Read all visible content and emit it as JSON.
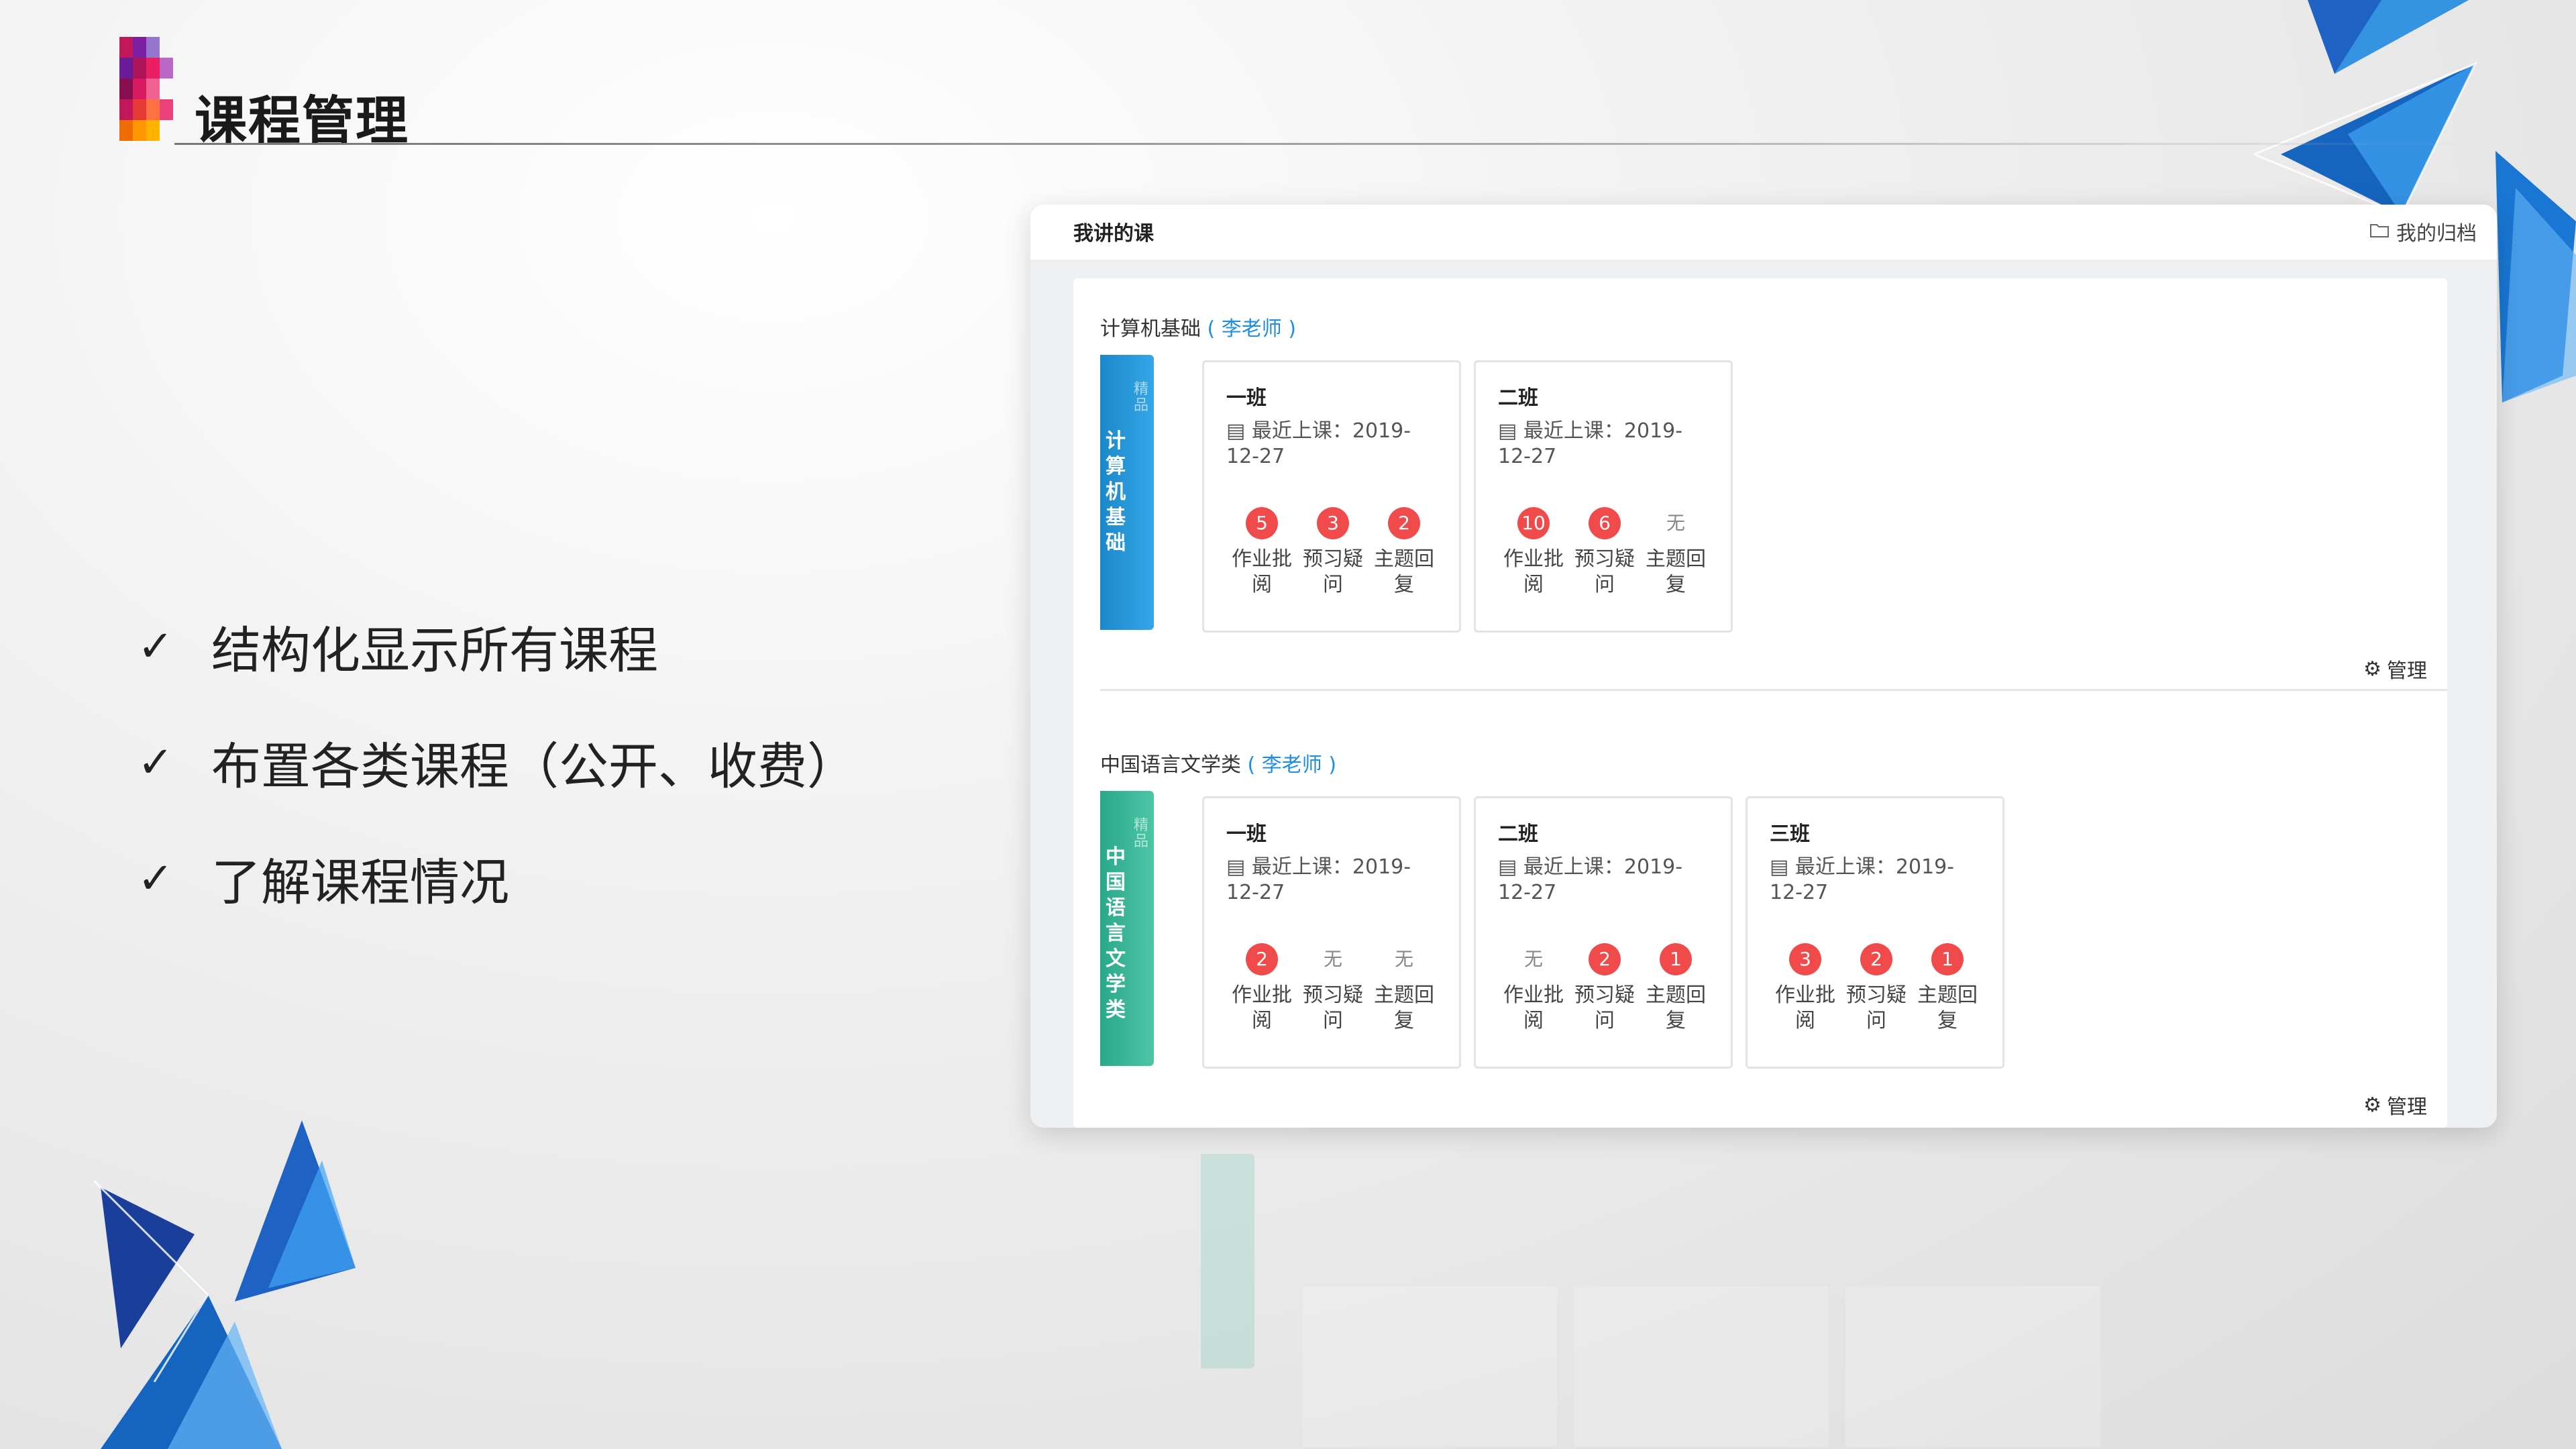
{
  "slide": {
    "title": "课程管理",
    "bullets": [
      {
        "icon": "check-icon",
        "glyph": "✓",
        "text": "结构化显示所有课程"
      },
      {
        "icon": "check-icon",
        "glyph": "✓",
        "text": "布置各类课程（公开、收费）"
      },
      {
        "icon": "check-icon",
        "glyph": "✓",
        "text": "了解课程情况"
      }
    ]
  },
  "panel": {
    "title": "我讲的课",
    "archive_label": "我的归档",
    "manage_label": "管理",
    "date_prefix": "最近上课：2019-12-27",
    "stat_labels": [
      "作业批阅",
      "预习疑问",
      "主题回复"
    ],
    "courses": [
      {
        "name": "计算机基础",
        "teacher": "( 李老师 )",
        "book_color": "#2196d8",
        "book_label": "计算机基础",
        "classes": [
          {
            "name": "一班",
            "date": "最近上课：2019-12-27",
            "stats": [
              "5",
              "3",
              "2"
            ]
          },
          {
            "name": "二班",
            "date": "最近上课：2019-12-27",
            "stats": [
              "10",
              "6",
              "无"
            ]
          }
        ]
      },
      {
        "name": "中国语言文学类",
        "teacher": "( 李老师 )",
        "book_color": "#3cb89a",
        "book_label": "中国语言文学类",
        "classes": [
          {
            "name": "一班",
            "date": "最近上课：2019-12-27",
            "stats": [
              "2",
              "无",
              "无"
            ]
          },
          {
            "name": "二班",
            "date": "最近上课：2019-12-27",
            "stats": [
              "无",
              "2",
              "1"
            ]
          },
          {
            "name": "三班",
            "date": "最近上课：2019-12-27",
            "stats": [
              "3",
              "2",
              "1"
            ]
          }
        ]
      }
    ]
  },
  "colors": {
    "badge": "#f04a4a",
    "teacher_link": "#1f8ee0",
    "decor_blue": "#1565c0"
  }
}
